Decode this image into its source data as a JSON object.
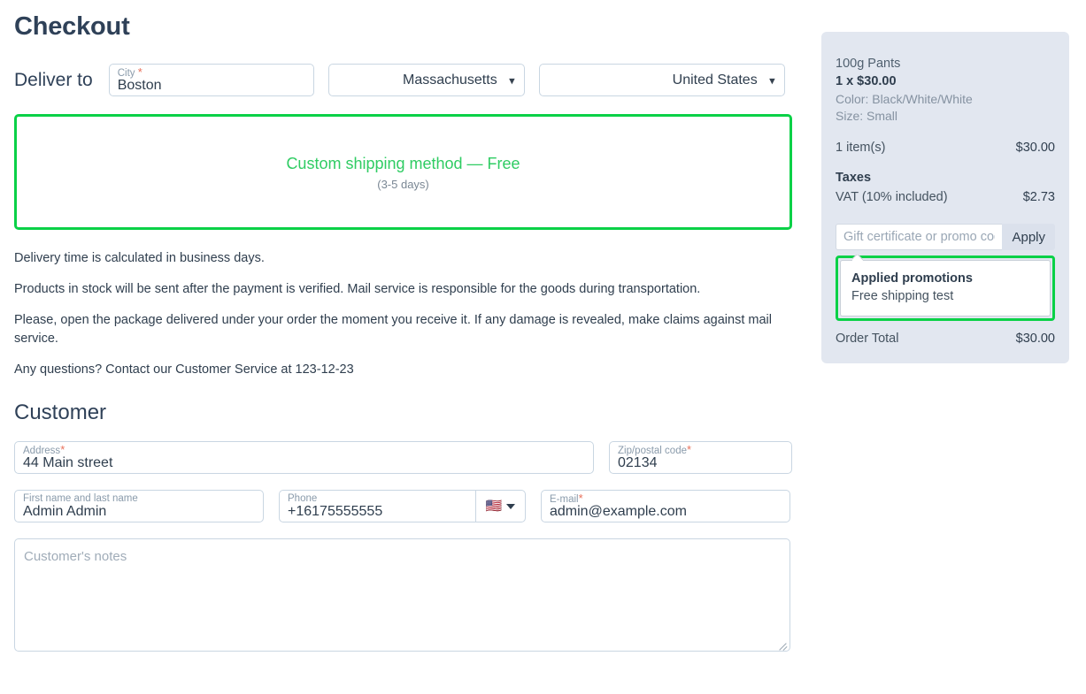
{
  "page": {
    "title": "Checkout"
  },
  "deliver": {
    "label": "Deliver to",
    "city": {
      "label": "City",
      "required_mark": "*",
      "value": "Boston",
      "placeholder": "City"
    },
    "state": {
      "value": "Massachusetts",
      "options": [
        "Massachusetts"
      ],
      "chevron": "chevron-down-icon"
    },
    "country": {
      "value": "United States",
      "options": [
        "United States"
      ],
      "chevron": "chevron-down-icon"
    }
  },
  "shipping": {
    "method": "Custom shipping method — Free",
    "eta": "(3-5 days)",
    "highlight_color": "#0ad147",
    "method_color": "#2fcc63"
  },
  "delivery_info": {
    "paragraphs": [
      "Delivery time is calculated in business days.",
      "Products in stock will be sent after the payment is verified. Mail service is responsible for the goods during transportation.",
      "Please, open the package delivered under your order the moment you receive it. If any damage is revealed, make claims against mail service.",
      "Any questions? Contact our Customer Service at 123-12-23"
    ]
  },
  "customer": {
    "heading": "Customer",
    "address": {
      "label": "Address",
      "required_mark": "*",
      "value": "44 Main street",
      "placeholder": "Address"
    },
    "zip": {
      "label": "Zip/postal code",
      "required_mark": "*",
      "value": "02134",
      "placeholder": "Zip/postal code"
    },
    "name": {
      "label": "First name and last name",
      "value": "Admin Admin",
      "placeholder": "First name and last name"
    },
    "phone": {
      "label": "Phone",
      "value": "+16175555555",
      "placeholder": "Phone",
      "flag": "🇺🇸",
      "flag_icon_name": "us-flag-icon"
    },
    "email": {
      "label": "E-mail",
      "required_mark": "*",
      "value": "admin@example.com",
      "placeholder": "E-mail"
    },
    "notes": {
      "placeholder": "Customer's notes",
      "value": ""
    }
  },
  "summary": {
    "product": {
      "name": "100g Pants",
      "qty_price": "1 x $30.00",
      "options": [
        "Color: Black/White/White",
        "Size: Small"
      ]
    },
    "items": {
      "label": "1 item(s)",
      "value": "$30.00"
    },
    "taxes": {
      "heading": "Taxes",
      "rows": [
        {
          "label": "VAT (10% included)",
          "value": "$2.73"
        }
      ]
    },
    "promo": {
      "placeholder": "Gift certificate or promo code",
      "value": "",
      "apply_label": "Apply"
    },
    "applied_promotions": {
      "title": "Applied promotions",
      "items": [
        "Free shipping test"
      ],
      "highlight_color": "#0ad147"
    },
    "order_total": {
      "label": "Order Total",
      "value": "$30.00"
    },
    "background_color": "#e2e7f0"
  }
}
